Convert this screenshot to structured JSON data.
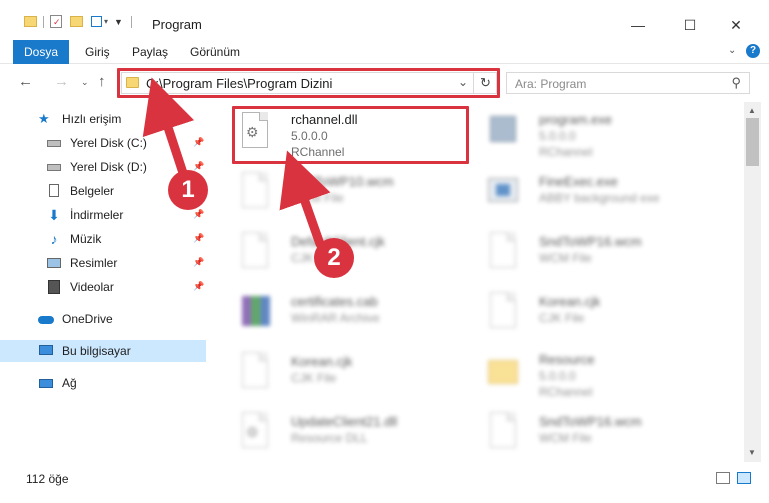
{
  "window": {
    "title": "Program",
    "minimize": "—",
    "maximize": "☐",
    "close": "✕"
  },
  "ribbon": {
    "tabs": [
      "Dosya",
      "Giriş",
      "Paylaş",
      "Görünüm"
    ]
  },
  "address": {
    "path": "C:\\Program Files\\Program Dizini",
    "search_placeholder": "Ara: Program"
  },
  "sidebar": {
    "items": [
      {
        "label": "Hızlı erişim",
        "icon": "star-icon"
      },
      {
        "label": "Yerel Disk (C:)",
        "icon": "drive-icon"
      },
      {
        "label": "Yerel Disk (D:)",
        "icon": "drive-icon"
      },
      {
        "label": "Belgeler",
        "icon": "documents-icon"
      },
      {
        "label": "İndirmeler",
        "icon": "download-icon"
      },
      {
        "label": "Müzik",
        "icon": "music-icon"
      },
      {
        "label": "Resimler",
        "icon": "pictures-icon"
      },
      {
        "label": "Videolar",
        "icon": "videos-icon"
      },
      {
        "label": "OneDrive",
        "icon": "cloud-icon"
      },
      {
        "label": "Bu bilgisayar",
        "icon": "computer-icon"
      },
      {
        "label": "Ağ",
        "icon": "network-icon"
      }
    ]
  },
  "files": [
    {
      "name": "rchannel.dll",
      "version": "5.0.0.0",
      "desc": "RChannel"
    },
    {
      "name": "program.exe",
      "version": "5.0.0.0",
      "desc": "RChannel"
    },
    {
      "name": "SndToWP10.wcm",
      "version": "",
      "desc": "WCM File"
    },
    {
      "name": "FineExec.exe",
      "version": "",
      "desc": "ABBY background exe"
    },
    {
      "name": "DefaultClient.cjk",
      "version": "",
      "desc": "CJK File"
    },
    {
      "name": "SndToWP16.wcm",
      "version": "",
      "desc": "WCM File"
    },
    {
      "name": "certificates.cab",
      "version": "",
      "desc": "WinRAR Archive"
    },
    {
      "name": "Korean.cjk",
      "version": "",
      "desc": "CJK File"
    },
    {
      "name": "Korean.cjk",
      "version": "",
      "desc": "CJK File"
    },
    {
      "name": "Resource",
      "version": "5.0.0.0",
      "desc": "RChannel"
    },
    {
      "name": "UpdateClient21.dll",
      "version": "",
      "desc": "Resource DLL"
    },
    {
      "name": "SndToWP16.wcm",
      "version": "",
      "desc": "WCM File"
    }
  ],
  "status": {
    "count": "112 öğe"
  },
  "callouts": [
    "1",
    "2"
  ],
  "colors": {
    "accent": "#1979ca",
    "highlight": "#d9333f",
    "selected": "#cce8ff"
  }
}
